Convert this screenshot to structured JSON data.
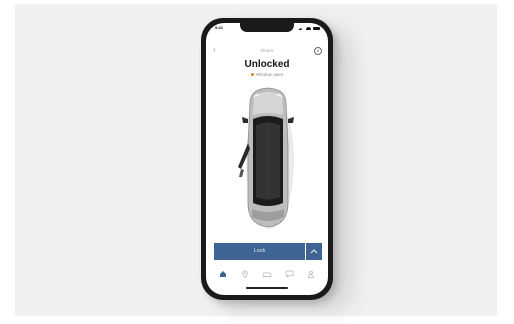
{
  "status_bar": {
    "time": "9:41"
  },
  "header": {
    "label": "Doors",
    "back_icon": "chevron-left-icon",
    "info_icon": "info-icon"
  },
  "status": {
    "title": "Unlocked",
    "subtitle": "Window open",
    "indicator_color": "#e87a1e"
  },
  "actions": {
    "lock_label": "Lock",
    "expand_icon": "chevron-up-icon",
    "accent_color": "#3d6493"
  },
  "tabbar": {
    "items": [
      {
        "icon": "home-icon",
        "active": true
      },
      {
        "icon": "location-pin-icon",
        "active": false
      },
      {
        "icon": "car-icon",
        "active": false
      },
      {
        "icon": "message-icon",
        "active": false
      },
      {
        "icon": "profile-icon",
        "active": false
      }
    ]
  }
}
